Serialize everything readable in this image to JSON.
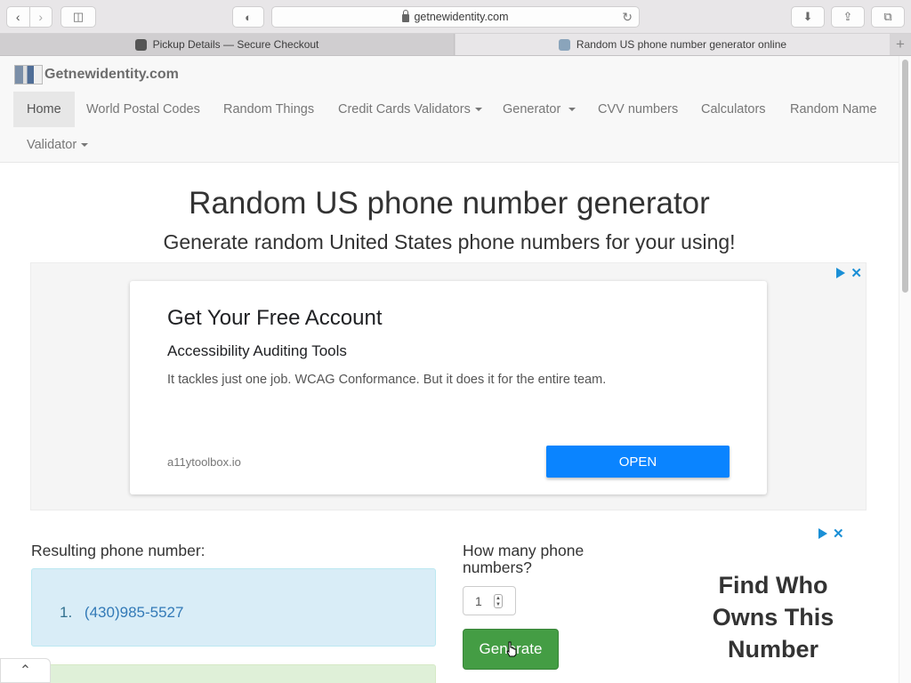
{
  "browser": {
    "url": "getnewidentity.com",
    "tabs": [
      {
        "title": "Pickup Details — Secure Checkout"
      },
      {
        "title": "Random US phone number generator online"
      }
    ]
  },
  "site": {
    "brand": "Getnewidentity.com",
    "nav": [
      {
        "label": "Home"
      },
      {
        "label": "World Postal Codes"
      },
      {
        "label": "Random Things"
      },
      {
        "label": "Credit Cards Validators"
      },
      {
        "label": "Generator"
      },
      {
        "label": "CVV numbers"
      },
      {
        "label": "Calculators"
      },
      {
        "label": "Random Name"
      },
      {
        "label": "Validator"
      }
    ]
  },
  "main": {
    "title": "Random US phone number generator",
    "subtitle": "Generate random United States phone numbers for your using!"
  },
  "ad": {
    "headline": "Get Your Free Account",
    "subheadline": "Accessibility Auditing Tools",
    "body": "It tackles just one job. WCAG Conformance. But it does it for the entire team.",
    "url": "a11ytoolbox.io",
    "cta": "OPEN"
  },
  "generator": {
    "result_label": "Resulting phone number:",
    "results": [
      {
        "index": "1.",
        "phone": "(430)985-5527"
      }
    ],
    "count_label": "How many phone numbers?",
    "count_value": "1",
    "generate_label": "Generate"
  },
  "ad2": {
    "text": "Find Who Owns This Number"
  },
  "colors": {
    "primary": "#0a84ff",
    "success": "#449d44",
    "info_bg": "#d9edf7"
  }
}
